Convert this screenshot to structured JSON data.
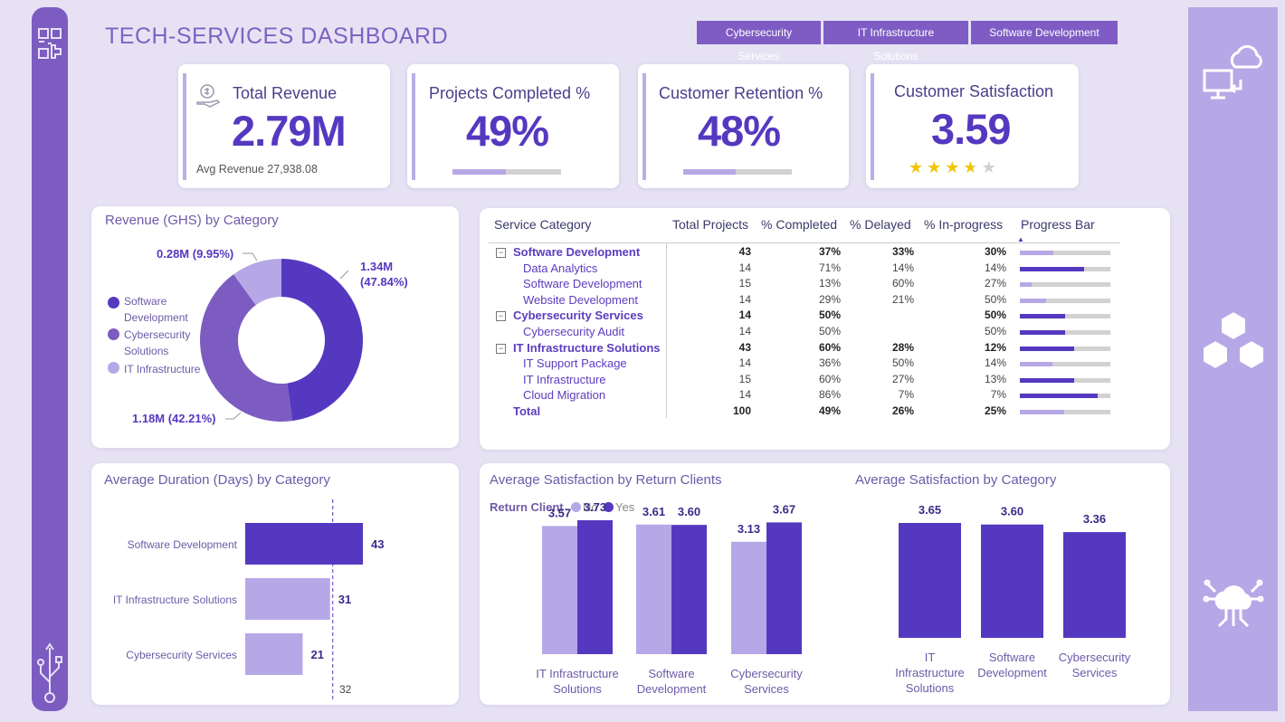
{
  "header": {
    "title": "TECH-SERVICES DASHBOARD",
    "tabs": [
      "Cybersecurity Services",
      "IT Infrastructure Solutions",
      "Software Development"
    ]
  },
  "kpis": {
    "revenue": {
      "label": "Total Revenue",
      "value": "2.79M",
      "sub": "Avg Revenue 27,938.08"
    },
    "projects": {
      "label": "Projects Completed %",
      "value": "49%",
      "progress": 0.49
    },
    "retention": {
      "label": "Customer Retention %",
      "value": "48%",
      "progress": 0.48
    },
    "satisfaction": {
      "label": "Customer Satisfaction",
      "value": "3.59",
      "stars": 3.59
    }
  },
  "colors": {
    "primary": "#5538c0",
    "mid": "#7c5cc0",
    "light": "#b6a8e6",
    "star": "#f2c500"
  },
  "revenue_card": {
    "title": "Revenue (GHS) by Category",
    "legend": [
      "Software Development",
      "Cybersecurity Solutions",
      "IT Infrastructure"
    ],
    "labels": {
      "top": "0.28M (9.95%)",
      "right1": "1.34M",
      "right2": "(47.84%)",
      "bottom": "1.18M (42.21%)"
    }
  },
  "table": {
    "headers": [
      "Service Category",
      "Total Projects",
      "% Completed",
      "% Delayed",
      "% In-progress",
      "Progress Bar"
    ],
    "rows": [
      {
        "name": "Software Development",
        "total": "43",
        "completed": "37%",
        "delayed": "33%",
        "inprog": "30%",
        "group": true,
        "p": 0.37
      },
      {
        "name": "Data Analytics",
        "total": "14",
        "completed": "71%",
        "delayed": "14%",
        "inprog": "14%",
        "group": false,
        "p": 0.71
      },
      {
        "name": "Software Development",
        "total": "15",
        "completed": "13%",
        "delayed": "60%",
        "inprog": "27%",
        "group": false,
        "p": 0.13
      },
      {
        "name": "Website Development",
        "total": "14",
        "completed": "29%",
        "delayed": "21%",
        "inprog": "50%",
        "group": false,
        "p": 0.29
      },
      {
        "name": "Cybersecurity Services",
        "total": "14",
        "completed": "50%",
        "delayed": "",
        "inprog": "50%",
        "group": true,
        "p": 0.5
      },
      {
        "name": "Cybersecurity Audit",
        "total": "14",
        "completed": "50%",
        "delayed": "",
        "inprog": "50%",
        "group": false,
        "p": 0.5
      },
      {
        "name": "IT Infrastructure Solutions",
        "total": "43",
        "completed": "60%",
        "delayed": "28%",
        "inprog": "12%",
        "group": true,
        "p": 0.6
      },
      {
        "name": "IT Support Package",
        "total": "14",
        "completed": "36%",
        "delayed": "50%",
        "inprog": "14%",
        "group": false,
        "p": 0.36
      },
      {
        "name": "IT Infrastructure",
        "total": "15",
        "completed": "60%",
        "delayed": "27%",
        "inprog": "13%",
        "group": false,
        "p": 0.6
      },
      {
        "name": "Cloud Migration",
        "total": "14",
        "completed": "86%",
        "delayed": "7%",
        "inprog": "7%",
        "group": false,
        "p": 0.86
      },
      {
        "name": "Total",
        "total": "100",
        "completed": "49%",
        "delayed": "26%",
        "inprog": "25%",
        "group": true,
        "p": 0.49
      }
    ]
  },
  "duration_card": {
    "title": "Average Duration (Days) by Category",
    "avg_line_label": "32"
  },
  "return_card": {
    "title": "Average Satisfaction by Return Clients",
    "legend_title": "Return Client",
    "legend": [
      "No",
      "Yes"
    ]
  },
  "category_card": {
    "title": "Average Satisfaction by Category"
  },
  "chart_data": [
    {
      "type": "pie",
      "title": "Revenue (GHS) by Category",
      "categories": [
        "Software Development",
        "Cybersecurity Solutions",
        "IT Infrastructure"
      ],
      "values": [
        1.34,
        1.18,
        0.28
      ],
      "percent": [
        47.84,
        42.21,
        9.95
      ]
    },
    {
      "type": "bar",
      "title": "Average Duration (Days) by Category",
      "categories": [
        "Software Development",
        "IT Infrastructure Solutions",
        "Cybersecurity Services"
      ],
      "values": [
        43,
        31,
        21
      ],
      "reference_line": 32,
      "xlim": [
        0,
        50
      ]
    },
    {
      "type": "bar",
      "title": "Average Satisfaction by Return Clients",
      "categories": [
        "IT Infrastructure Solutions",
        "Software Development",
        "Cybersecurity Services"
      ],
      "series": [
        {
          "name": "No",
          "values": [
            3.57,
            3.61,
            3.13
          ]
        },
        {
          "name": "Yes",
          "values": [
            3.73,
            3.6,
            3.67
          ]
        }
      ],
      "ylim": [
        0,
        4
      ]
    },
    {
      "type": "bar",
      "title": "Average Satisfaction by Category",
      "categories": [
        "IT Infrastructure Solutions",
        "Software Development",
        "Cybersecurity Services"
      ],
      "values": [
        3.65,
        3.6,
        3.36
      ],
      "ylim": [
        0,
        4
      ]
    }
  ]
}
